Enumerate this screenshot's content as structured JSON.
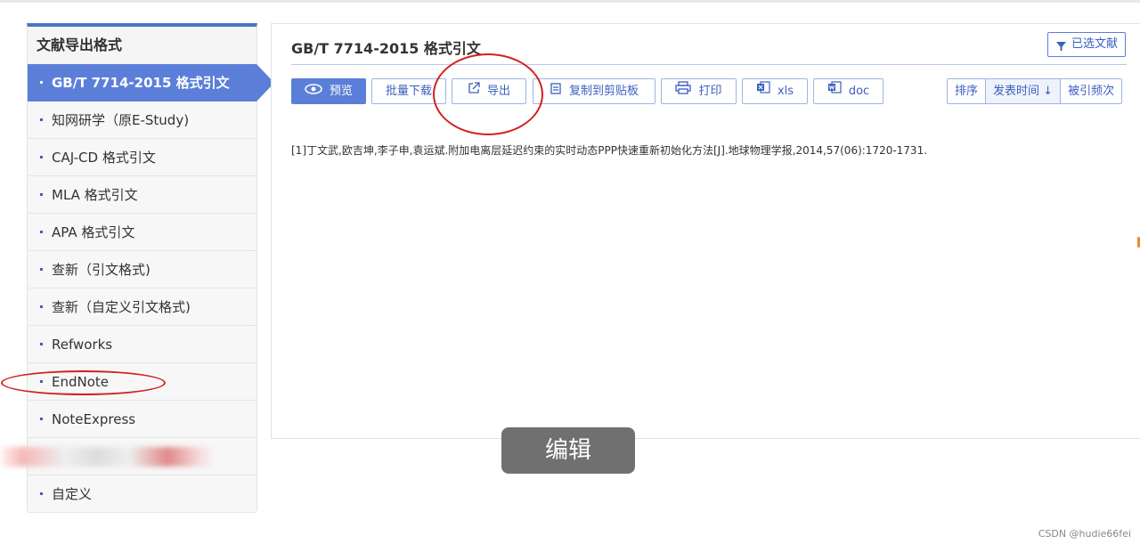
{
  "sidebar": {
    "title": "文献导出格式",
    "items": [
      {
        "label": "GB/T 7714-2015 格式引文",
        "active": true
      },
      {
        "label": "知网研学（原E-Study)"
      },
      {
        "label": "CAJ-CD 格式引文"
      },
      {
        "label": "MLA 格式引文"
      },
      {
        "label": "APA 格式引文"
      },
      {
        "label": "查新（引文格式)"
      },
      {
        "label": "查新（自定义引文格式)"
      },
      {
        "label": "Refworks"
      },
      {
        "label": "EndNote"
      },
      {
        "label": "NoteExpress"
      },
      {
        "label": ""
      },
      {
        "label": "自定义"
      }
    ]
  },
  "main": {
    "title": "GB/T 7714-2015 格式引文",
    "selected_label": "已选文献",
    "toolbar": {
      "preview": "预览",
      "batch_download": "批量下载",
      "export": "导出",
      "copy": "复制到剪贴板",
      "print": "打印",
      "xls": "xls",
      "doc": "doc"
    },
    "sort": {
      "label": "排序",
      "pub_time": "发表时间",
      "cited": "被引频次"
    },
    "citation": "[1]丁文武,欧吉坤,李子申,袁运斌.附加电离层延迟约束的实时动态PPP快速重新初始化方法[J].地球物理学报,2014,57(06):1720-1731."
  },
  "overlay": {
    "tooltip": "编辑",
    "watermark": "CSDN @hudie66fei"
  },
  "colors": {
    "accent": "#5b7fd9",
    "accent_text": "#3b5fc0",
    "annotation": "#d22020"
  }
}
